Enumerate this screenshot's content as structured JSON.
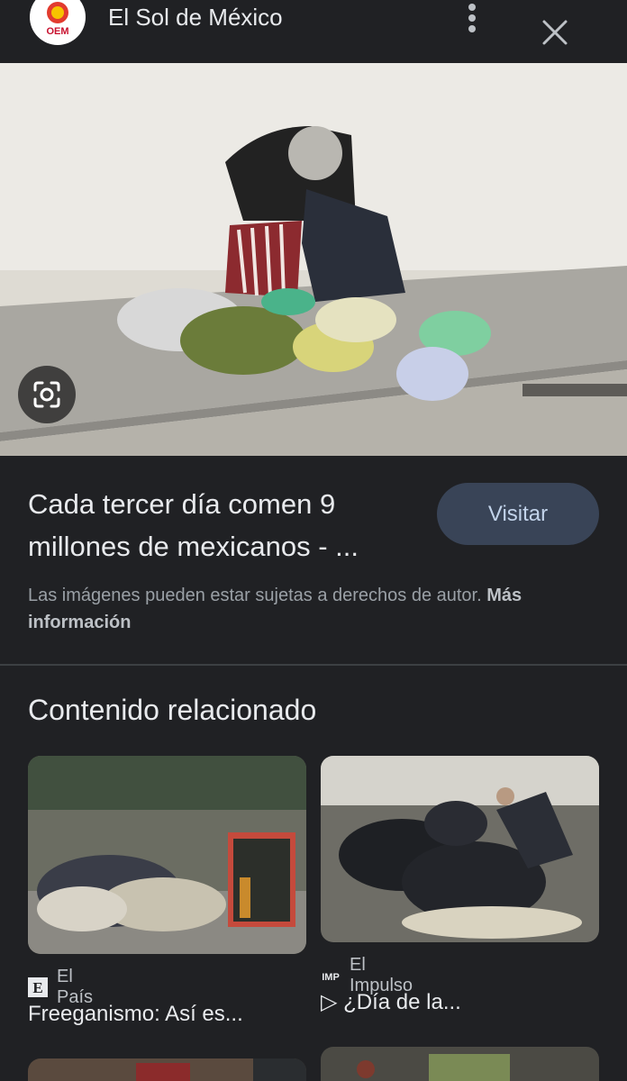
{
  "header": {
    "site_name": "El Sol de México",
    "logo_text": "OEM"
  },
  "result": {
    "title_line1": "Cada tercer día comen 9",
    "title_line2": "millones de mexicanos - ...",
    "visit_label": "Visitar",
    "copyright_text": "Las imágenes pueden estar sujetas a derechos de autor.",
    "more_info_label": "Más información"
  },
  "related": {
    "heading": "Contenido relacionado",
    "items": [
      {
        "source": "El País",
        "title": "Freeganismo: Así es...",
        "icon": "E"
      },
      {
        "source": "El Impulso",
        "title": "▷ ¿Día de la...",
        "icon": "IMP"
      }
    ]
  }
}
